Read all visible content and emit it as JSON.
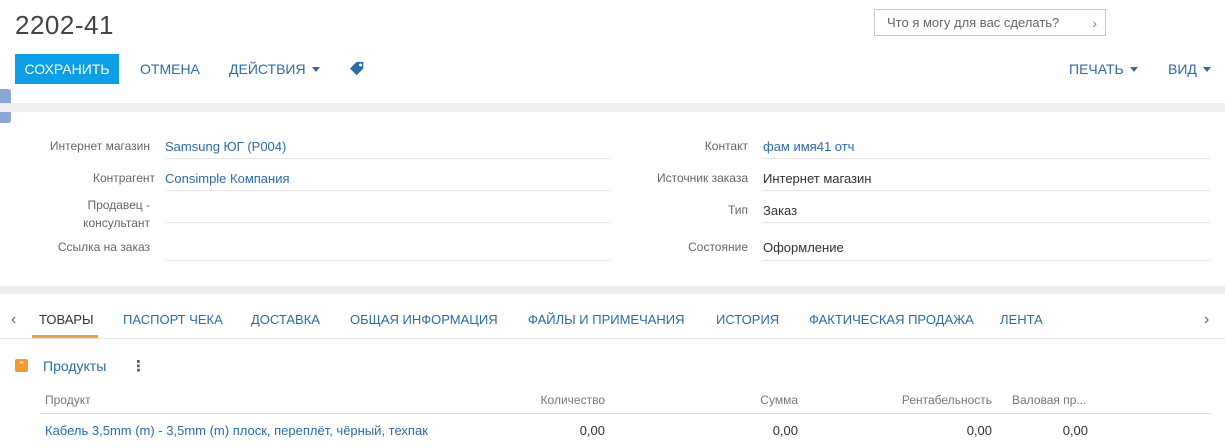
{
  "header": {
    "title": "2202-41",
    "search_placeholder": "Что я могу для вас сделать?"
  },
  "toolbar": {
    "save": "СОХРАНИТЬ",
    "cancel": "ОТМЕНА",
    "actions": "ДЕЙСТВИЯ",
    "print": "ПЕЧАТЬ",
    "view": "ВИД"
  },
  "fields": {
    "shop": {
      "label": "Интернет магазин",
      "value": "Samsung ЮГ (P004)"
    },
    "counterparty": {
      "label": "Контрагент",
      "value": "Consimple Компания"
    },
    "seller": {
      "label_line1": "Продавец -",
      "label_line2": "консультант",
      "value": ""
    },
    "order_link": {
      "label": "Ссылка на заказ",
      "value": ""
    },
    "contact": {
      "label": "Контакт",
      "value": "фам имя41 отч"
    },
    "source": {
      "label": "Источник заказа",
      "value": "Интернет магазин"
    },
    "type": {
      "label": "Тип",
      "value": "Заказ"
    },
    "state": {
      "label": "Состояние",
      "value": "Оформление"
    }
  },
  "tabs": [
    "ТОВАРЫ",
    "ПАСПОРТ ЧЕКА",
    "ДОСТАВКА",
    "ОБЩАЯ ИНФОРМАЦИЯ",
    "ФАЙЛЫ И ПРИМЕЧАНИЯ",
    "ИСТОРИЯ",
    "ФАКТИЧЕСКАЯ ПРОДАЖА",
    "ЛЕНТА"
  ],
  "products": {
    "title": "Продукты",
    "columns": [
      "Продукт",
      "Количество",
      "Сумма",
      "Рентабельность",
      "Валовая пр..."
    ],
    "rows": [
      {
        "product": "Кабель 3,5mm (m) - 3,5mm (m) плоск, переплёт, чёрный, техпак",
        "qty": "0,00",
        "sum": "0,00",
        "profit": "0,00",
        "gross": "0,00"
      }
    ]
  },
  "colors": {
    "accent": "#0d9ee5",
    "link": "#2e6ba8",
    "tab_underline": "#f0a24a",
    "collapse": "#f39a33"
  },
  "icons": [
    "tag-icon",
    "chevron-right-icon",
    "chevron-left-icon",
    "caret-down-icon",
    "kebab-menu-icon",
    "collapse-icon"
  ]
}
